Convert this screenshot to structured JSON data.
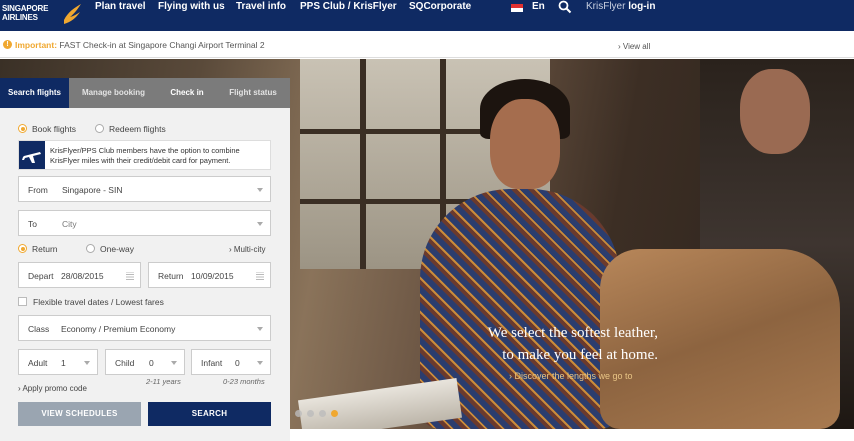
{
  "nav": {
    "logo_line1": "SINGAPORE",
    "logo_line2": "AIRLINES",
    "items": [
      "Plan travel",
      "Flying with us",
      "Travel info",
      "PPS Club / KrisFlyer",
      "SQCorporate"
    ],
    "lang": "En",
    "login_prefix": "KrisFlyer",
    "login_suffix": "log-in",
    "icons": {
      "search": "search-icon",
      "flag": "singapore-flag-icon"
    }
  },
  "notice": {
    "label": "Important:",
    "text": "FAST Check-in at Singapore Changi Airport Terminal 2",
    "view_all": "View all"
  },
  "booking": {
    "tabs": [
      "Search flights",
      "Manage booking",
      "Check in",
      "Flight status"
    ],
    "active_tab": "Search flights",
    "mode_book": "Book flights",
    "mode_redeem": "Redeem flights",
    "info": "KrisFlyer/PPS Club members have the option to combine KrisFlyer miles with their credit/debit card for payment.",
    "from_label": "From",
    "from_value": "Singapore - SIN",
    "to_label": "To",
    "to_placeholder": "City",
    "trip_return": "Return",
    "trip_oneway": "One-way",
    "trip_multi": "Multi-city",
    "depart_label": "Depart",
    "depart_value": "28/08/2015",
    "return_label": "Return",
    "return_value": "10/09/2015",
    "flexible": "Flexible travel dates / Lowest fares",
    "class_label": "Class",
    "class_value": "Economy / Premium Economy",
    "adult_label": "Adult",
    "adult_value": "1",
    "child_label": "Child",
    "child_value": "0",
    "child_note": "2-11 years",
    "infant_label": "Infant",
    "infant_value": "0",
    "infant_note": "0-23 months",
    "promo": "Apply promo code",
    "btn_schedules": "VIEW SCHEDULES",
    "btn_search": "SEARCH"
  },
  "hero": {
    "line1": "We select the softest leather,",
    "line2": "to make you feel at home.",
    "link": "Discover the lengths we go to",
    "slides": 4,
    "active_slide": 4,
    "accent": "#f0a830"
  },
  "colors": {
    "navy": "#0f2a63",
    "accent": "#f0a830",
    "grey_tab": "#7b7b7b",
    "btn_grey": "#9aa5b1"
  }
}
